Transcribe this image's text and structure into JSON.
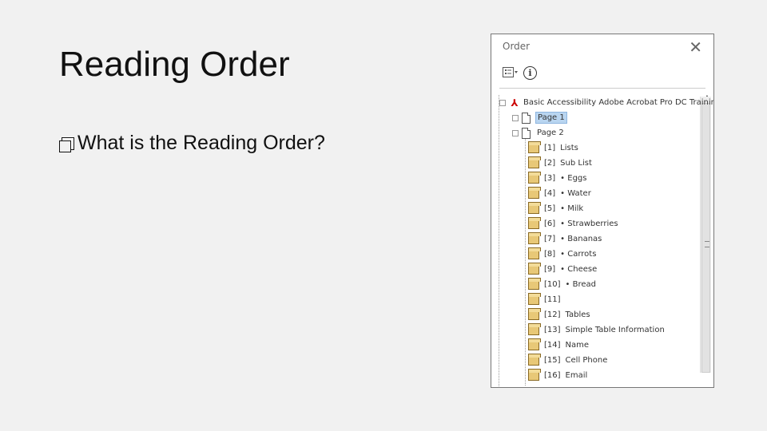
{
  "slide": {
    "title": "Reading Order",
    "bullet": "What is the Reading Order?"
  },
  "panel": {
    "title": "Order",
    "root_label": "Basic Accessibility Adobe Acrobat Pro DC Training",
    "pages": [
      {
        "label": "Page 1",
        "selected": true
      },
      {
        "label": "Page 2",
        "selected": false
      }
    ],
    "items": [
      {
        "num": "[1]",
        "text": "Lists"
      },
      {
        "num": "[2]",
        "text": "Sub List"
      },
      {
        "num": "[3]",
        "text": "• Eggs"
      },
      {
        "num": "[4]",
        "text": "• Water"
      },
      {
        "num": "[5]",
        "text": "• Milk"
      },
      {
        "num": "[6]",
        "text": "• Strawberries"
      },
      {
        "num": "[7]",
        "text": "• Bananas"
      },
      {
        "num": "[8]",
        "text": "• Carrots"
      },
      {
        "num": "[9]",
        "text": "• Cheese"
      },
      {
        "num": "[10]",
        "text": "• Bread"
      },
      {
        "num": "[11]",
        "text": ""
      },
      {
        "num": "[12]",
        "text": "Tables"
      },
      {
        "num": "[13]",
        "text": "Simple Table Information"
      },
      {
        "num": "[14]",
        "text": "Name"
      },
      {
        "num": "[15]",
        "text": "Cell Phone"
      },
      {
        "num": "[16]",
        "text": "Email"
      }
    ],
    "icons": {
      "close": "close-icon",
      "options": "options-menu-icon",
      "info": "info-icon",
      "root": "pdf-icon",
      "page": "page-icon",
      "item": "content-box-icon"
    }
  }
}
